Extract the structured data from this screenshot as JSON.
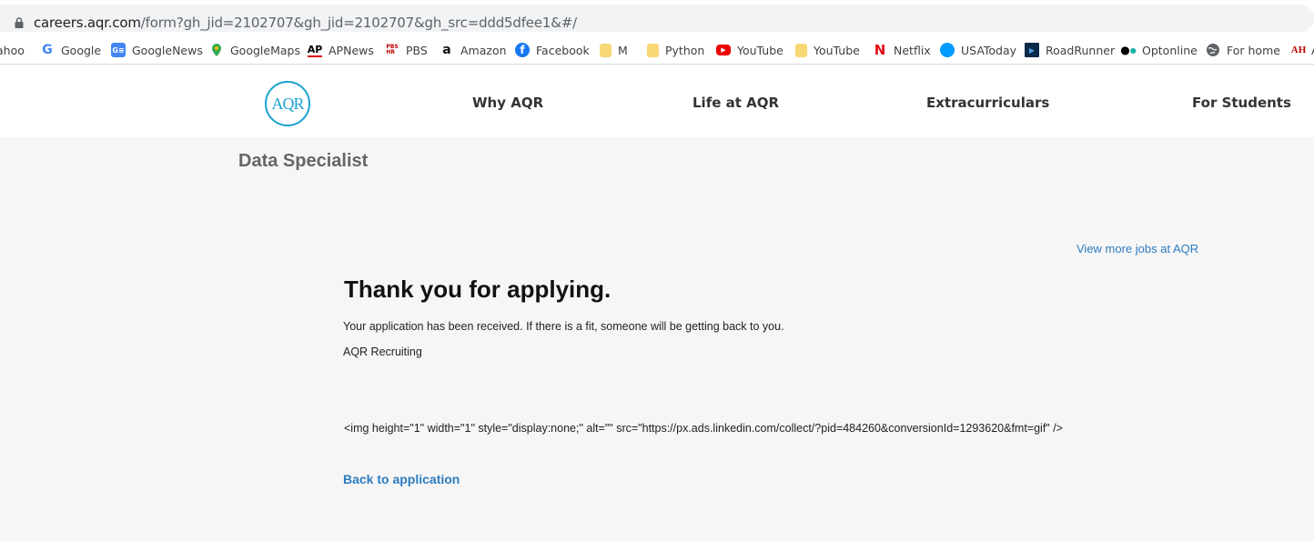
{
  "browser": {
    "url_host": "careers.aqr.com",
    "url_path": "/form?gh_jid=2102707&gh_jid=2102707&gh_src=ddd5dfee1&#/"
  },
  "bookmarks": [
    {
      "label": "ahoo",
      "icon": "yahoo-icon"
    },
    {
      "label": "Google",
      "icon": "google-icon"
    },
    {
      "label": "GoogleNews",
      "icon": "google-news-icon"
    },
    {
      "label": "GoogleMaps",
      "icon": "google-maps-icon"
    },
    {
      "label": "APNews",
      "icon": "apnews-icon"
    },
    {
      "label": "PBS",
      "icon": "pbs-icon"
    },
    {
      "label": "Amazon",
      "icon": "amazon-icon"
    },
    {
      "label": "Facebook",
      "icon": "facebook-icon"
    },
    {
      "label": "M",
      "icon": "folder-icon"
    },
    {
      "label": "Python",
      "icon": "folder-icon"
    },
    {
      "label": "YouTube",
      "icon": "youtube-icon"
    },
    {
      "label": "YouTube",
      "icon": "folder-icon"
    },
    {
      "label": "Netflix",
      "icon": "netflix-icon"
    },
    {
      "label": "USAToday",
      "icon": "usatoday-icon"
    },
    {
      "label": "RoadRunner",
      "icon": "roadrunner-icon"
    },
    {
      "label": "Optonline",
      "icon": "optonline-icon"
    },
    {
      "label": "For home",
      "icon": "globe-icon"
    },
    {
      "label": "A",
      "icon": "ah-icon"
    }
  ],
  "site": {
    "logo_text": "AQR",
    "nav": [
      "Why AQR",
      "Life at AQR",
      "Extracurriculars",
      "For Students"
    ]
  },
  "page": {
    "job_title": "Data Specialist",
    "view_more": "View more jobs at AQR",
    "heading": "Thank you for applying.",
    "message": "Your application has been received. If there is a fit, someone will be getting back to you.",
    "signature": "AQR Recruiting",
    "raw_code": "<img height=\"1\" width=\"1\" style=\"display:none;\" alt=\"\" src=\"https://px.ads.linkedin.com/collect/?pid=484260&conversionId=1293620&fmt=gif\" />",
    "back_link": "Back to application"
  }
}
